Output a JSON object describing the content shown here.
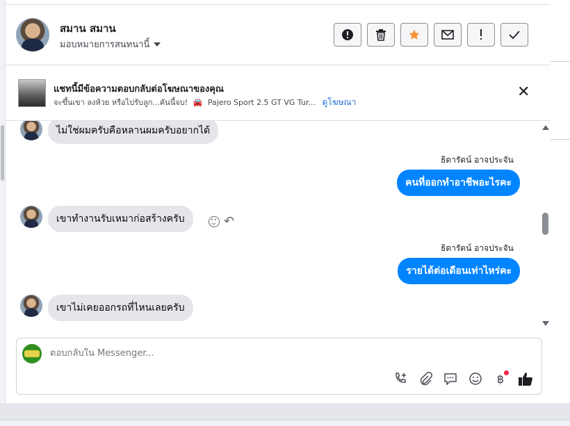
{
  "header": {
    "name": "สมาน สมาน",
    "assign_label": "มอบหมายการสนทนานี้",
    "action_icons": [
      "spam-icon",
      "trash-icon",
      "star-icon",
      "envelope-icon",
      "exclamation-icon",
      "check-icon"
    ],
    "star_color": "#f7923a"
  },
  "ad": {
    "title": "แชทนี้มีข้อความตอบกลับต่อโฆษณาของคุณ",
    "subtitle": "จะขึ้นเขา ลงห้วย หรือไปรับลูก...คันนี้จบ!",
    "car_glyph": "🚘",
    "product": "Pajero Sport 2.5 GT VG Tur...",
    "link": "ดูโฆษณา"
  },
  "messages": [
    {
      "side": "in",
      "text": "ไม่ใช่ผมครับคือหลานผมครับอยากได้"
    },
    {
      "side": "out",
      "sender": "ธิดารัตน์ อาจประจัน",
      "text": "คนที่ออกทำอาชีพอะไรคะ"
    },
    {
      "side": "in",
      "text": "เขาทำงานรับเหมาก่อสร้างครับ"
    },
    {
      "side": "out",
      "sender": "ธิดารัตน์ อาจประจัน",
      "text": "รายได้ต่อเดือนเท่าไหร่คะ"
    },
    {
      "side": "in",
      "text": "เขาไม่เคยออกรถที่ไหนเลยครับ"
    }
  ],
  "composer": {
    "placeholder": "ตอบกลับใน Messenger...",
    "baht_symbol": "฿"
  },
  "colors": {
    "outgoing_bubble": "#0084ff",
    "incoming_bubble": "#e4e6eb",
    "link": "#216fdb"
  }
}
